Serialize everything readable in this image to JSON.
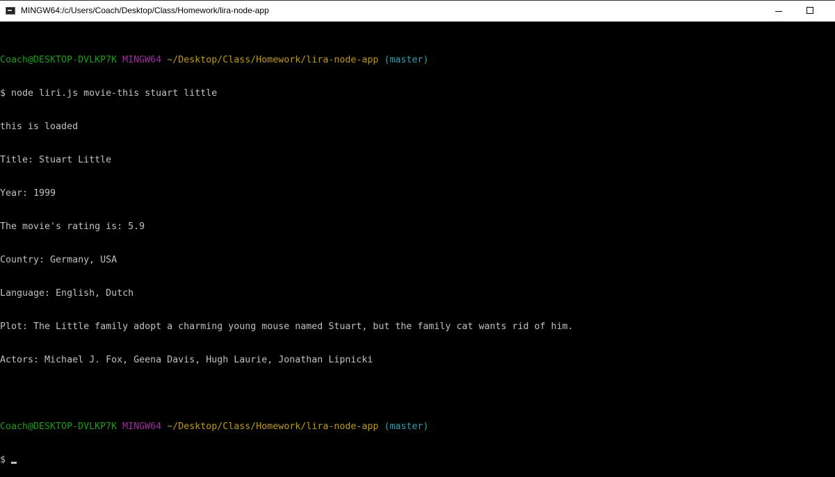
{
  "window": {
    "title": "MINGW64:/c/Users/Coach/Desktop/Class/Homework/lira-node-app"
  },
  "prompt": {
    "user_host": "Coach@DESKTOP-DVLKP7K",
    "system": "MINGW64",
    "path": "~/Desktop/Class/Homework/lira-node-app",
    "branch": "(master)",
    "symbol": "$"
  },
  "command": "node liri.js movie-this stuart little",
  "output": [
    "this is loaded",
    "Title: Stuart Little",
    "Year: 1999",
    "The movie's rating is: 5.9",
    "Country: Germany, USA",
    "Language: English, Dutch",
    "Plot: The Little family adopt a charming young mouse named Stuart, but the family cat wants rid of him.",
    "Actors: Michael J. Fox, Geena Davis, Hugh Laurie, Jonathan Lipnicki"
  ],
  "colors": {
    "user_host": "#13a10e",
    "system": "#a12aa1",
    "path": "#c19c00",
    "branch": "#2aa1b3",
    "text": "#c0c0c0"
  }
}
